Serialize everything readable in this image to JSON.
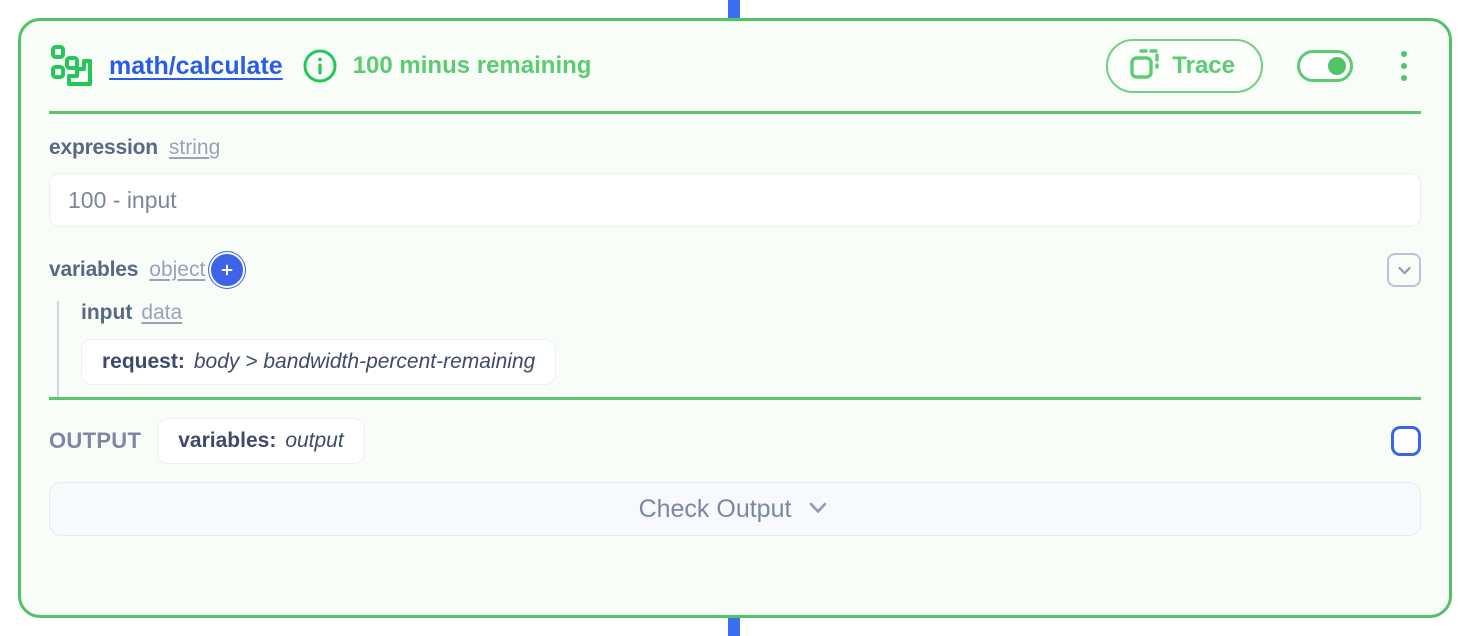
{
  "node": {
    "type_icon": "workflow-blocks-icon",
    "link_label": "math/calculate",
    "info_icon": "info-circle-icon",
    "subtitle": "100 minus remaining",
    "trace_label": "Trace",
    "trace_icon": "duplicate-dashed-icon",
    "toggle_state": "on",
    "menu_icon": "kebab-menu-icon",
    "accent_color": "#4fc365",
    "link_color": "#2b5ce6",
    "card_bg": "#f9fdf7"
  },
  "fields": {
    "expression": {
      "name": "expression",
      "type": "string",
      "value": "100 - input"
    },
    "variables": {
      "name": "variables",
      "type": "object",
      "add_icon": "plus-circle-icon",
      "collapse_icon": "chevron-down-icon",
      "children": [
        {
          "name": "input",
          "type": "data",
          "chip_key": "request:",
          "chip_value": "body > bandwidth-percent-remaining"
        }
      ]
    }
  },
  "output": {
    "label": "OUTPUT",
    "chip_key": "variables:",
    "chip_value": "output",
    "checkbox_state": "unchecked",
    "check_button_label": "Check Output",
    "check_button_icon": "chevron-down-icon"
  },
  "connectors": {
    "color": "#3b6ef0"
  }
}
